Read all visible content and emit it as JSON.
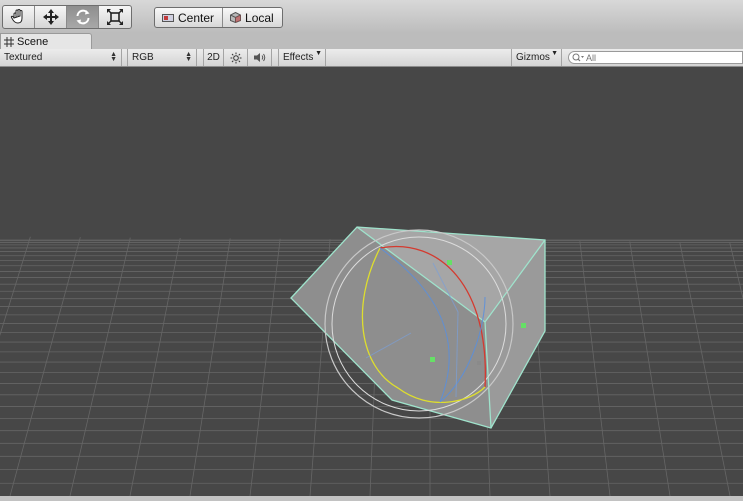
{
  "toolbar": {
    "tools": [
      {
        "name": "hand-icon",
        "active": false
      },
      {
        "name": "move-icon",
        "active": false
      },
      {
        "name": "rotate-icon",
        "active": true
      },
      {
        "name": "scale-icon",
        "active": false
      }
    ],
    "pivot_label": "Center",
    "space_label": "Local"
  },
  "tab": {
    "label": "Scene"
  },
  "scenebar": {
    "draw_mode": "Textured",
    "render_mode": "RGB",
    "mode_2d": "2D",
    "effects": "Effects",
    "gizmos": "Gizmos",
    "search_placeholder": "All"
  },
  "viewport": {
    "background": "#474747",
    "grid_color": "#6a6a6a",
    "cube_outline": "#9fe3cc",
    "gizmo_x_color": "#d43a2f",
    "gizmo_y_color": "#dede2e",
    "gizmo_z_color": "#5b8fdc",
    "handle_color": "#66e066"
  }
}
